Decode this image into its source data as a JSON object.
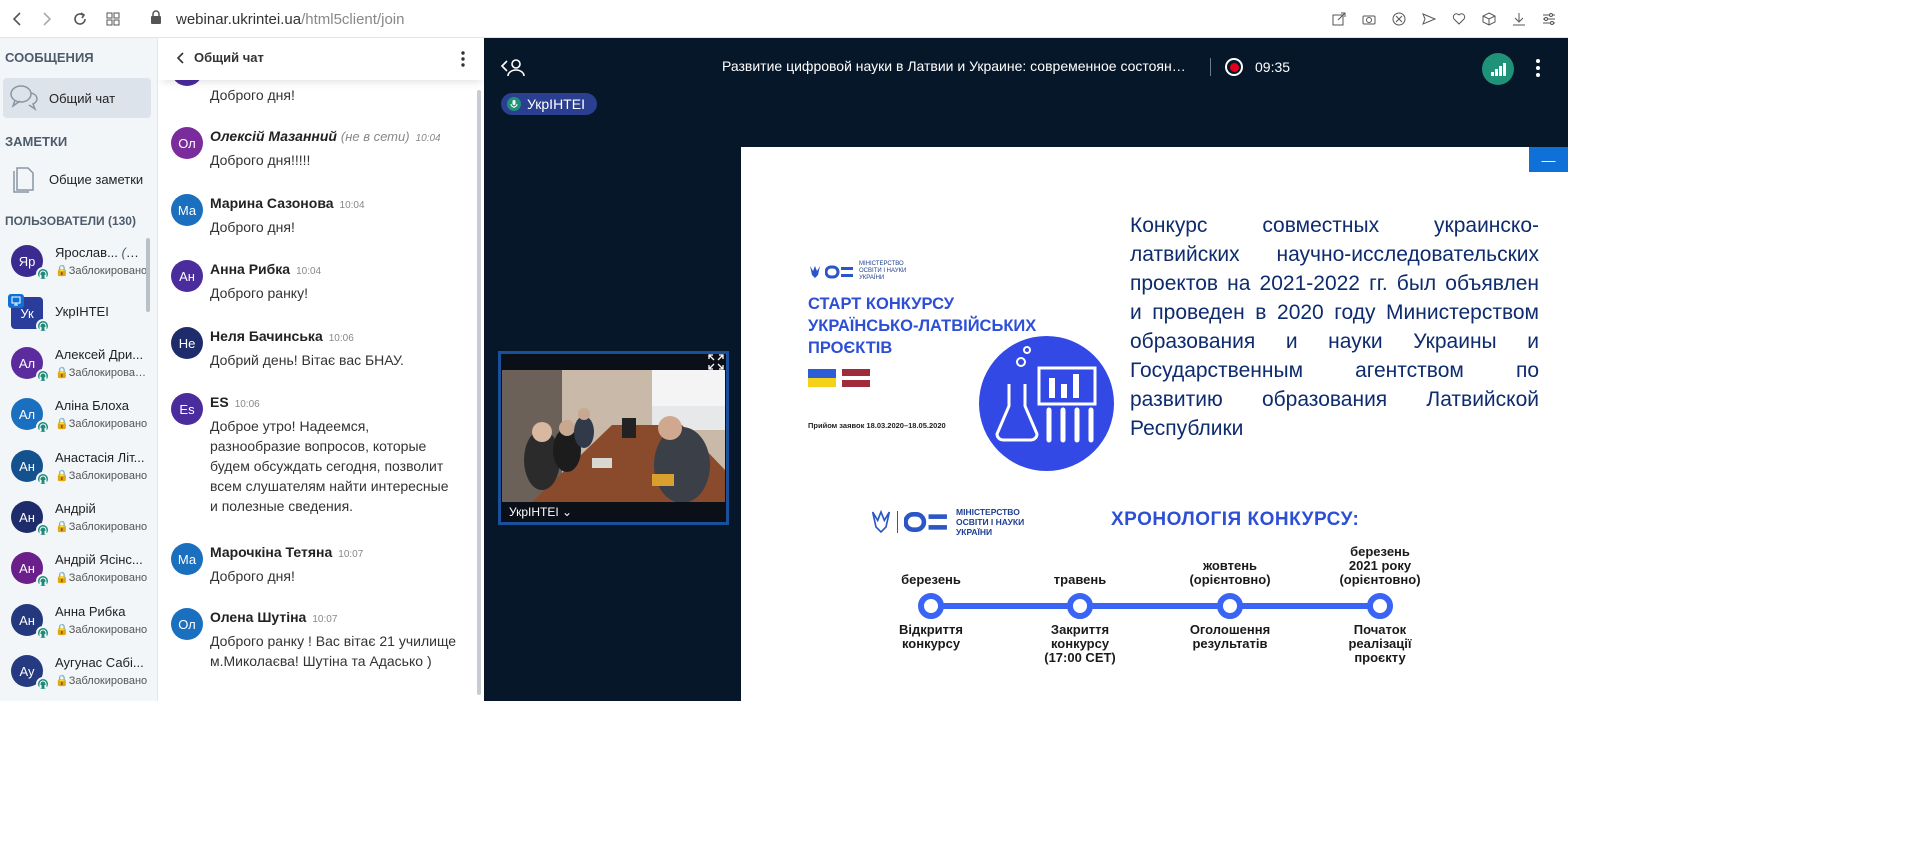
{
  "browser": {
    "url_host": "webinar.ukrintei.ua",
    "url_path": "/html5client/join"
  },
  "sidebar": {
    "messages_title": "СООБЩЕНИЯ",
    "public_chat_label": "Общий чат",
    "notes_title": "ЗАМЕТКИ",
    "shared_notes_label": "Общие заметки",
    "users_title": "ПОЛЬЗОВАТЕЛИ (130)",
    "users": [
      {
        "initials": "Яр",
        "name": "Ярослав...",
        "you": "(Вы)",
        "status": "Заблокировано",
        "color": "#3b2a8f"
      },
      {
        "initials": "Ук",
        "name": "УкрІНТЕІ",
        "status": "",
        "color": "#2b3d9a"
      },
      {
        "initials": "Ал",
        "name": "Алексей Дри...",
        "status": "Заблокирован...",
        "color": "#5c2c9f"
      },
      {
        "initials": "Ал",
        "name": "Аліна Блоха",
        "status": "Заблокировано",
        "color": "#1a6fbf"
      },
      {
        "initials": "Ан",
        "name": "Анастасія Літ...",
        "status": "Заблокировано",
        "color": "#14528f"
      },
      {
        "initials": "Ан",
        "name": "Андрій",
        "status": "Заблокировано",
        "color": "#1e2c6b"
      },
      {
        "initials": "Ан",
        "name": "Андрій Ясінс...",
        "status": "Заблокировано",
        "color": "#6a1f8a"
      },
      {
        "initials": "Ан",
        "name": "Анна Рибка",
        "status": "Заблокировано",
        "color": "#24397d"
      },
      {
        "initials": "Ау",
        "name": "Аугунас Сабі...",
        "status": "Заблокировано",
        "color": "#253a80"
      }
    ]
  },
  "chat": {
    "title": "Общий чат",
    "partial_top_text": "Доброго дня!",
    "messages": [
      {
        "initials": "Ол",
        "name": "Олексій Мазанний",
        "offline": "(не в сети)",
        "time": "10:04",
        "text": "Доброго дня!!!!!",
        "color": "#7a2c9c",
        "italic": true
      },
      {
        "initials": "Ма",
        "name": "Марина Сазонова",
        "offline": "",
        "time": "10:04",
        "text": "Доброго дня!",
        "color": "#1a6fbf"
      },
      {
        "initials": "Ан",
        "name": "Анна Рибка",
        "offline": "",
        "time": "10:04",
        "text": "Доброго ранку!",
        "color": "#4a2c9c"
      },
      {
        "initials": "Не",
        "name": "Неля Бачинська",
        "offline": "",
        "time": "10:06",
        "text": "Добрий день! Вітає вас БНАУ.",
        "color": "#1e2c6b"
      },
      {
        "initials": "Es",
        "name": "ES",
        "offline": "",
        "time": "10:06",
        "text": "Доброе утро! Надеемся, разнообразие вопросов, которые будем обсуждать сегодня, позволит всем слушателям найти интересные и полезные сведения.",
        "color": "#4a2c9c"
      },
      {
        "initials": "Ма",
        "name": "Марочкіна Тетяна",
        "offline": "",
        "time": "10:07",
        "text": "Доброго дня!",
        "color": "#1a6fbf"
      },
      {
        "initials": "Ол",
        "name": "Олена Шутіна",
        "offline": "",
        "time": "10:07",
        "text": "Доброго ранку ! Вас вітає 21 училище м.Миколаєва! Шутіна та Адасько )",
        "color": "#1a6fbf"
      }
    ]
  },
  "meeting": {
    "title": "Развитие цифровой науки в Латвии и Украине: современное состояние...",
    "record_time": "09:35",
    "talker": "УкрІНТЕІ",
    "webcam_label": "УкрІНТЕІ ⌄",
    "minimize_label": "—"
  },
  "slide": {
    "text": "Конкурс совместных украинско-латвийских научно-исследовательских проектов на 2021-2022 гг. был объявлен и проведен в 2020 году Министерством образования и науки Украины и Государственным агентством по развитию образования Латвийской Республики",
    "poster_logo": "МІНІСТЕРСТВО ОСВІТИ І НАУКИ УКРАЇНИ",
    "poster_title": "СТАРТ КОНКУРСУ\nУКРАЇНСЬКО-ЛАТВІЙСЬКИХ\nПРОЄКТІВ",
    "poster_dates": "Прийом заявок 18.03.2020–18.05.2020",
    "timeline_logo": "МІНІСТЕРСТВО ОСВІТИ І НАУКИ УКРАЇНИ",
    "timeline_title": "ХРОНОЛОГІЯ КОНКУРСУ:",
    "timeline": [
      {
        "top": "березень",
        "bottom": "Відкриття\nконкурсу"
      },
      {
        "top": "травень",
        "bottom": "Закриття\nконкурсу\n(17:00 CET)"
      },
      {
        "top": "жовтень\n(орієнтовно)",
        "bottom": "Оголошення\nрезультатів"
      },
      {
        "top": "березень\n2021 року\n(орієнтовно)",
        "bottom": "Початок\nреалізації\nпроєкту"
      }
    ]
  },
  "colors": {
    "accent": "#0f70d7",
    "dark_bg": "#06172a",
    "green": "#1e9377",
    "record": "#e0001d"
  }
}
